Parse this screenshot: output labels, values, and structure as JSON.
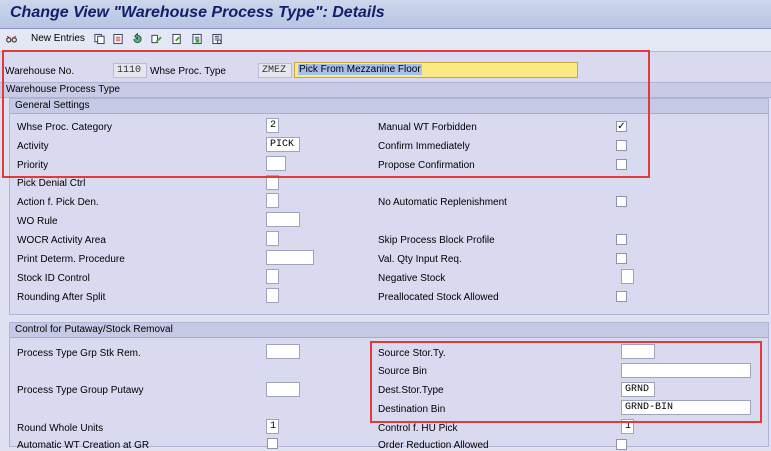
{
  "title": "Change View \"Warehouse Process Type\": Details",
  "toolbar": {
    "new_entries": "New Entries",
    "icons": [
      "glasses-icon",
      "copy-icon",
      "delete-icon",
      "undo-icon",
      "transport-icon",
      "prev-entry-icon",
      "next-entry-icon",
      "detail-icon"
    ]
  },
  "header": {
    "warehouse_label": "Warehouse No.",
    "warehouse_value": "1110",
    "proc_type_label": "Whse Proc. Type",
    "proc_type_value": "ZMEZ",
    "proc_type_desc": "Pick From Mezzanine Floor"
  },
  "section_title": "Warehouse Process Type",
  "general": {
    "title": "General Settings",
    "category_label": "Whse Proc. Category",
    "category_value": "2",
    "activity_label": "Activity",
    "activity_value": "PICK",
    "priority_label": "Priority",
    "pick_denial_label": "Pick Denial Ctrl",
    "action_pick_den_label": "Action f. Pick Den.",
    "wo_rule_label": "WO Rule",
    "wocr_label": "WOCR Activity Area",
    "print_label": "Print Determ. Procedure",
    "stock_id_label": "Stock ID Control",
    "rounding_label": "Rounding After Split",
    "manual_wt_label": "Manual WT Forbidden",
    "manual_wt_checked": true,
    "confirm_label": "Confirm Immediately",
    "propose_label": "Propose Confirmation",
    "no_auto_repl_label": "No Automatic Replenishment",
    "skip_block_label": "Skip Process Block Profile",
    "val_qty_label": "Val. Qty Input Req.",
    "negative_stock_label": "Negative Stock",
    "prealloc_label": "Preallocated Stock Allowed"
  },
  "control": {
    "title": "Control for Putaway/Stock Removal",
    "grp_stk_rem_label": "Process Type Grp Stk Rem.",
    "grp_putaway_label": "Process Type Group Putawy",
    "round_whole_label": "Round Whole Units",
    "round_whole_value": "1",
    "auto_wt_label": "Automatic WT Creation at GR",
    "source_stor_label": "Source Stor.Ty.",
    "source_bin_label": "Source Bin",
    "dest_stor_label": "Dest.Stor.Type",
    "dest_stor_value": "GRND",
    "dest_bin_label": "Destination Bin",
    "dest_bin_value": "GRND-BIN",
    "hu_pick_label": "Control f. HU Pick",
    "hu_pick_value": "1",
    "order_red_label": "Order Reduction Allowed"
  }
}
